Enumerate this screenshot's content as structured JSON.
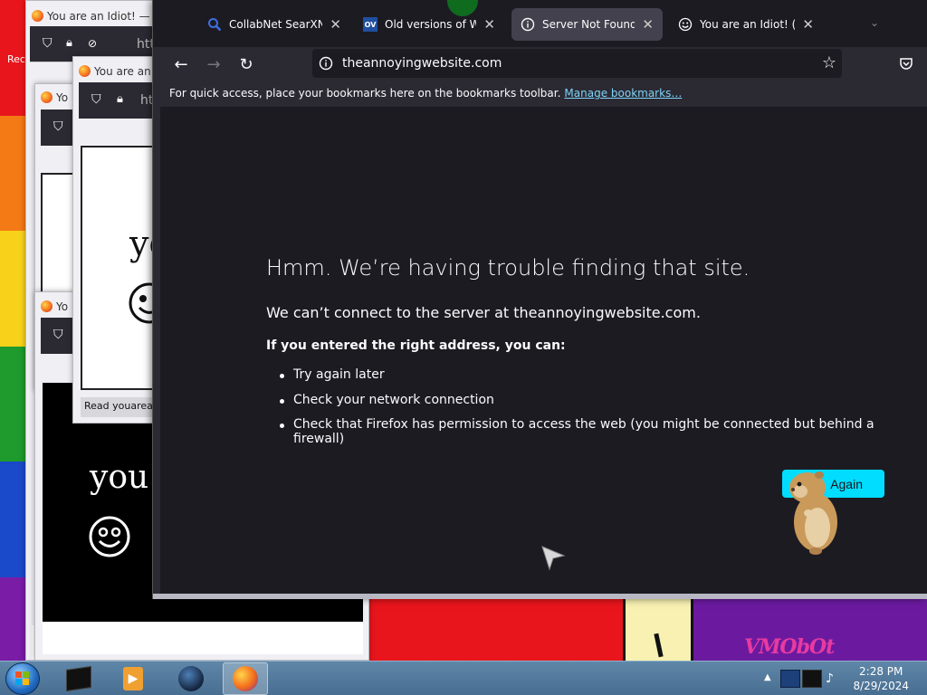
{
  "wallpaper": {
    "rainbow": [
      "#e8161c",
      "#f47a15",
      "#f8d21a",
      "#1f9a2c",
      "#1a49c9",
      "#7a1ca6"
    ],
    "logo_text": "VMObOt",
    "clipped_text": "Rec"
  },
  "popups": [
    {
      "title": "You are an Idiot! — M",
      "url_fragment": "htt"
    },
    {
      "title": "You are an",
      "url_fragment": "ht",
      "page_text": "yo",
      "status": "Read youarean"
    },
    {
      "title": "Yo"
    },
    {
      "title": "Yo",
      "page_text": "you"
    }
  ],
  "browser": {
    "tabs": [
      {
        "label": "CollabNet SearXNG",
        "icon": "search-icon",
        "active": false
      },
      {
        "label": "Old versions of Windows",
        "icon": "ov-icon",
        "active": false
      },
      {
        "label": "Server Not Found",
        "icon": "info-icon",
        "active": true
      },
      {
        "label": "You are an Idiot! (dot",
        "icon": "smiley-icon",
        "active": false
      }
    ],
    "url": "theannoyingwebsite.com",
    "bookmarks_text": "For quick access, place your bookmarks here on the bookmarks toolbar.",
    "bookmarks_link": "Manage bookmarks…",
    "error": {
      "title": "Hmm. We’re having trouble finding that site.",
      "line": "We can’t connect to the server at theannoyingwebsite.com.",
      "sub": "If you entered the right address, you can:",
      "items": [
        "Try again later",
        "Check your network connection",
        "Check that Firefox has permission to access the web (you might be connected but behind a firewall)"
      ],
      "try_again": "Again"
    }
  },
  "taskbar": {
    "time": "2:28 PM",
    "date": "8/29/2024"
  }
}
